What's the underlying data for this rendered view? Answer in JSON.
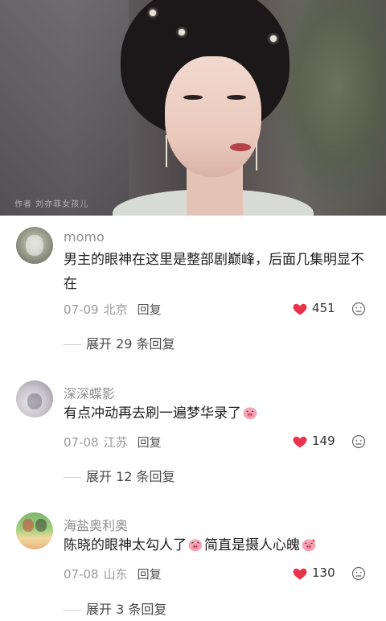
{
  "hero": {
    "watermark": "作者  刘亦菲女孩儿"
  },
  "comments": [
    {
      "username": "momo",
      "text": "男主的眼神在这里是整部剧巅峰，后面几集明显不在",
      "date": "07-09",
      "location": "北京",
      "reply_label": "回复",
      "likes": "451",
      "expand_label": "展开 29 条回复"
    },
    {
      "username": "深深蝶影",
      "text": "有点冲动再去刷一遍梦华录了",
      "date": "07-08",
      "location": "江苏",
      "reply_label": "回复",
      "likes": "149",
      "expand_label": "展开 12 条回复"
    },
    {
      "username": "海盐奥利奥",
      "text_part1": "陈晓的眼神太勾人了",
      "text_part2": "简直是摄人心魄",
      "date": "07-08",
      "location": "山东",
      "reply_label": "回复",
      "likes": "130",
      "expand_label": "展开 3 条回复"
    }
  ],
  "colors": {
    "heart": "#e8334a",
    "meta": "#9a9a9a"
  },
  "icons": {
    "like": "heart-icon",
    "dislike": "dislike-face-icon",
    "sticker": "pig-emoji-icon"
  }
}
